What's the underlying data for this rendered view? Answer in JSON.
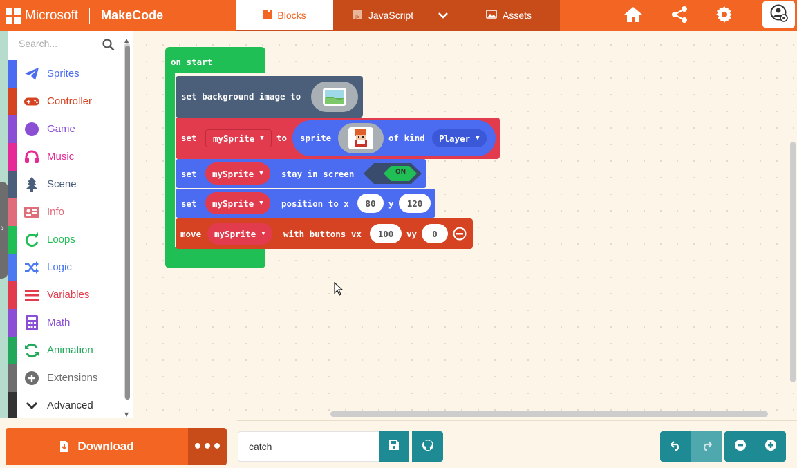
{
  "header": {
    "brand": "Microsoft",
    "product": "MakeCode",
    "tabs": {
      "blocks": "Blocks",
      "javascript": "JavaScript",
      "assets": "Assets"
    },
    "icons": [
      "home-icon",
      "share-icon",
      "settings-icon",
      "user-avatar-icon"
    ]
  },
  "toolbox": {
    "search_placeholder": "Search...",
    "categories": [
      {
        "label": "Sprites",
        "color": "#4b6bf0",
        "icon": "paper-plane-icon"
      },
      {
        "label": "Controller",
        "color": "#d54322",
        "icon": "gamepad-icon"
      },
      {
        "label": "Game",
        "color": "#8b4fd6",
        "icon": "circle-icon"
      },
      {
        "label": "Music",
        "color": "#e52a97",
        "icon": "headphones-icon"
      },
      {
        "label": "Scene",
        "color": "#4b5e7a",
        "icon": "tree-icon"
      },
      {
        "label": "Info",
        "color": "#e06d7a",
        "icon": "id-card-icon"
      },
      {
        "label": "Loops",
        "color": "#20bf55",
        "icon": "refresh-icon"
      },
      {
        "label": "Logic",
        "color": "#4b7af0",
        "icon": "shuffle-icon"
      },
      {
        "label": "Variables",
        "color": "#e23b4e",
        "icon": "list-icon"
      },
      {
        "label": "Math",
        "color": "#8b4fd6",
        "icon": "calculator-icon"
      },
      {
        "label": "Animation",
        "color": "#21a85a",
        "icon": "animation-icon"
      },
      {
        "label": "Extensions",
        "color": "#6e6e6e",
        "icon": "plus-circle-icon"
      },
      {
        "label": "Advanced",
        "color": "#333333",
        "icon": "chevron-down-icon"
      }
    ]
  },
  "workspace": {
    "on_start": "on start",
    "set_bg": "set background image to",
    "set_sprite": {
      "set": "set",
      "var": "mySprite",
      "to": "to",
      "sprite": "sprite",
      "of_kind": "of kind",
      "kind": "Player"
    },
    "stay_in_screen": {
      "set": "set",
      "var": "mySprite",
      "label": "stay in screen",
      "toggle": "ON"
    },
    "position": {
      "set": "set",
      "var": "mySprite",
      "label": "position to x",
      "x": "80",
      "y_label": "y",
      "y": "120"
    },
    "move": {
      "move": "move",
      "var": "mySprite",
      "label": "with buttons vx",
      "vx": "100",
      "vy_label": "vy",
      "vy": "0"
    }
  },
  "footer": {
    "download": "Download",
    "more": "•••",
    "project_name": "catch"
  },
  "colors": {
    "brand": "#f26522",
    "brand_dark": "#c84b1a",
    "teal": "#1e8a94",
    "loops_green": "#20bf55",
    "sprites_blue": "#4b6bf0",
    "variables_red": "#e23b4e",
    "scene_slate": "#4b5e7a",
    "controller_red": "#d54322"
  }
}
